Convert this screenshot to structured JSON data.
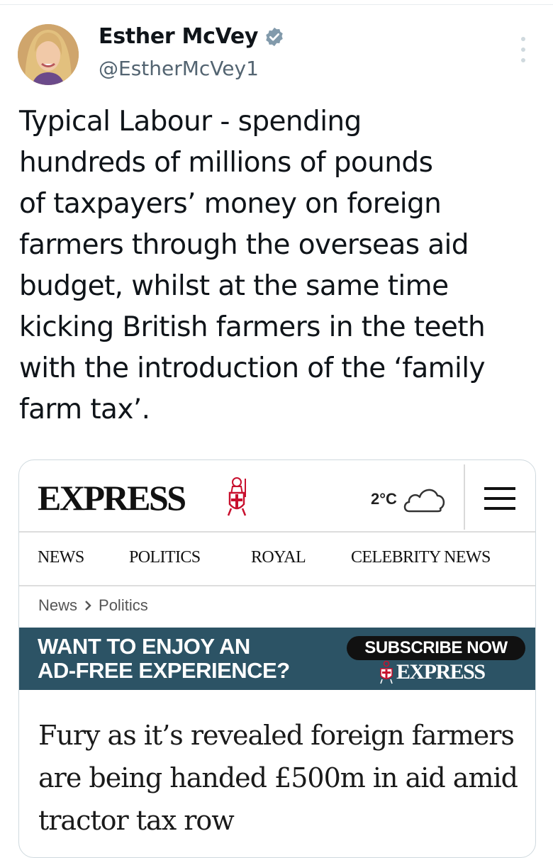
{
  "tweet": {
    "author_name": "Esther McVey",
    "handle": "@EstherMcVey1",
    "text": "Typical Labour - spending\nhundreds of millions of pounds\nof taxpayers’ money on foreign\nfarmers through the overseas aid\nbudget, whilst at the same time\nkicking British farmers in the teeth\nwith the introduction of the ‘family\nfarm tax’."
  },
  "card": {
    "logo": "EXPRESS",
    "temperature": "2°C",
    "nav": [
      "NEWS",
      "POLITICS",
      "ROYAL",
      "CELEBRITY NEWS"
    ],
    "breadcrumb": [
      "News",
      "Politics"
    ],
    "banner": {
      "text": "WANT TO ENJOY AN\nAD-FREE EXPERIENCE?",
      "subscribe_label": "SUBSCRIBE NOW",
      "logo": "EXPRESS"
    },
    "headline": "Fury as it’s revealed foreign farmers are being handed £500m in aid amid tractor tax row"
  },
  "colors": {
    "banner_bg": "#2c5365",
    "verified_badge": "#829aab",
    "crusader_red": "#c8102e"
  },
  "icons": [
    "verified-badge-icon",
    "more-options-icon",
    "crusader-logo-icon",
    "cloud-weather-icon",
    "hamburger-menu-icon",
    "chevron-right-icon"
  ]
}
